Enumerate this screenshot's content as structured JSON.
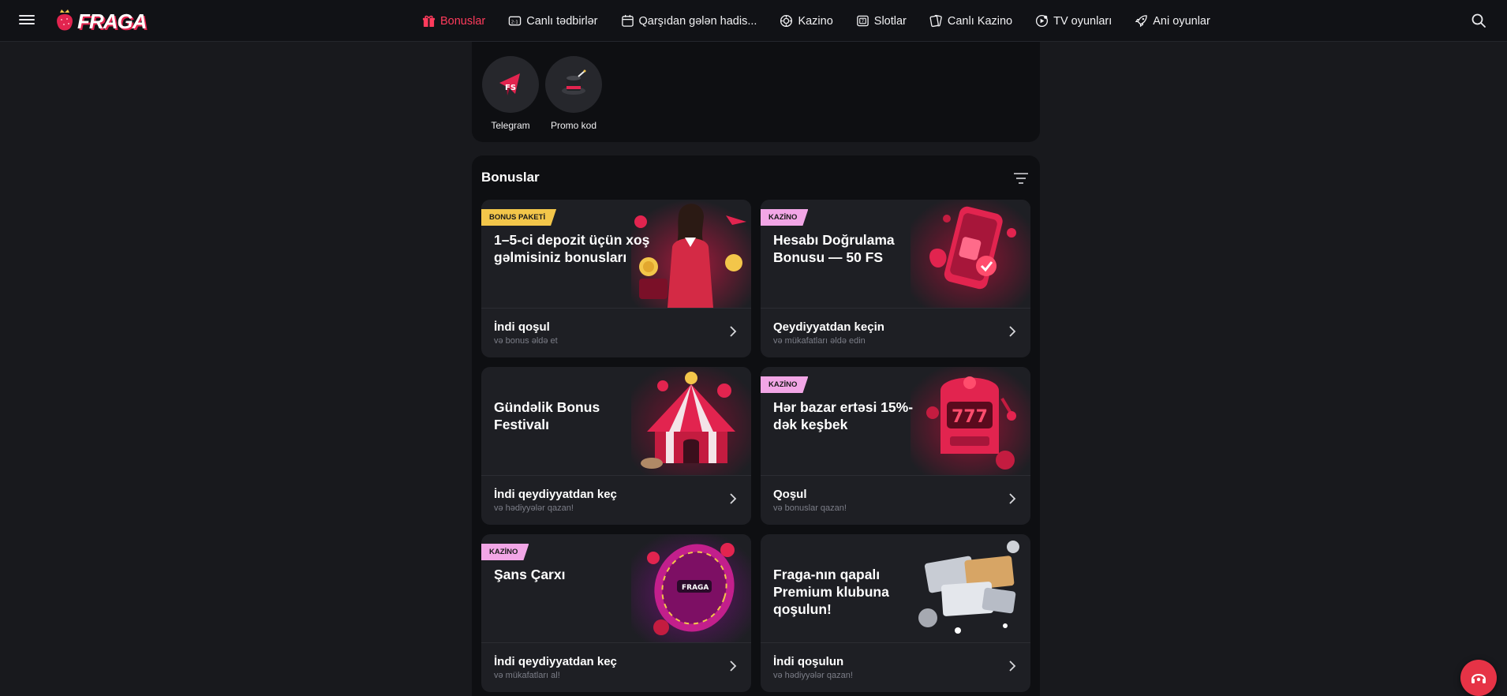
{
  "brand": {
    "name": "FRAGA"
  },
  "nav": {
    "items": [
      {
        "label": "Bonuslar",
        "icon": "gift-icon",
        "active": true
      },
      {
        "label": "Canlı tədbirlər",
        "icon": "live-scoreboard-icon"
      },
      {
        "label": "Qarşıdan gələn hadis...",
        "icon": "calendar-icon"
      },
      {
        "label": "Kazino",
        "icon": "casino-chip-icon"
      },
      {
        "label": "Slotlar",
        "icon": "slot-machine-icon"
      },
      {
        "label": "Canlı Kazino",
        "icon": "playing-cards-icon"
      },
      {
        "label": "TV oyunları",
        "icon": "tv-games-icon"
      },
      {
        "label": "Ani oyunlar",
        "icon": "rocket-icon"
      }
    ]
  },
  "quick_links": [
    {
      "label": "Telegram",
      "icon": "telegram-fs-icon"
    },
    {
      "label": "Promo kod",
      "icon": "magic-hat-icon"
    }
  ],
  "bonuses": {
    "title": "Bonuslar",
    "cards": [
      {
        "badge": "BONUS PAKETİ",
        "badge_color": "#f3c64a",
        "title": "1–5-ci depozit üçün xoş gəlmisiniz bonusları",
        "cta": "İndi qoşul",
        "sub": "və bonus əldə et",
        "art": "welcome-bonus-art"
      },
      {
        "badge": "KAZİNO",
        "badge_color": "#f2a6e6",
        "title": "Hesabı Doğrulama Bonusu — 50 FS",
        "cta": "Qeydiyyatdan keçin",
        "sub": "və mükafatları əldə edin",
        "art": "verified-phone-art"
      },
      {
        "badge": "",
        "title": "Gündəlik Bonus Festivalı",
        "cta": "İndi qeydiyyatdan keç",
        "sub": "və hədiyyələr qazan!",
        "art": "circus-tent-art"
      },
      {
        "badge": "KAZİNO",
        "badge_color": "#f2a6e6",
        "title": "Hər bazar ertəsi 15%-dək keşbek",
        "cta": "Qoşul",
        "sub": "və bonuslar qazan!",
        "art": "slot-machine-777-art"
      },
      {
        "badge": "KAZİNO",
        "badge_color": "#f2a6e6",
        "title": "Şans Çarxı",
        "cta": "İndi qeydiyyatdan keç",
        "sub": "və mükafatları al!",
        "art": "fortune-wheel-art"
      },
      {
        "badge": "",
        "title": "Fraga-nın qapalı Premium klubuna qoşulun!",
        "cta": "İndi qoşulun",
        "sub": "və hədiyyələr qazan!",
        "art": "premium-cards-art"
      }
    ]
  },
  "colors": {
    "accent": "#ff3b5c",
    "background": "#18191d",
    "panel": "#0e0f12",
    "card": "#1e1f24"
  }
}
